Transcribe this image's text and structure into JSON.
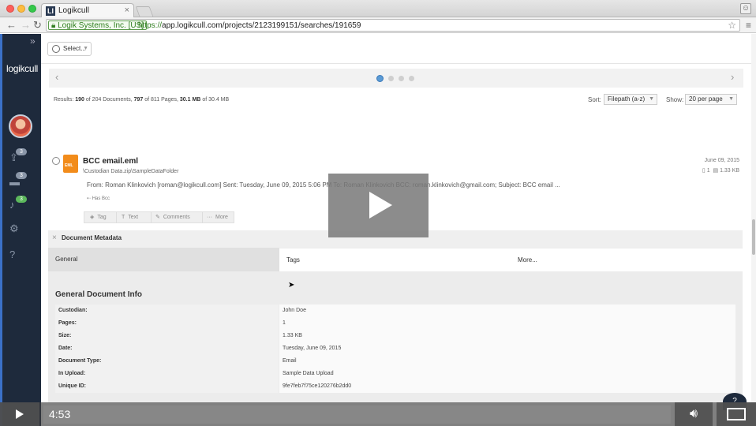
{
  "browser": {
    "tab_title": "Logikcull",
    "tab_favicon": "LI",
    "ev_cert": "Logik Systems, Inc. [US]",
    "url_protocol": "https://",
    "url_rest": "app.logikcull.com/projects/2123199151/searches/191659"
  },
  "app": {
    "logo": "logikcull",
    "badges": {
      "uploads": "3",
      "folders": "3",
      "notifications": "3"
    }
  },
  "toolbar": {
    "select_label": "Select..."
  },
  "results": {
    "summary_prefix": "Results:",
    "docs_shown": "190",
    "docs_of": "of 204 Documents,",
    "pages_shown": "797",
    "pages_of": "of 811 Pages,",
    "size_shown": "30.1 MB",
    "size_of": "of 30.4 MB",
    "sort_label": "Sort:",
    "sort_value": "Filepath (a-z)",
    "show_label": "Show:",
    "show_value": "20 per page"
  },
  "document": {
    "icon_label": "EML",
    "title": "BCC email.eml",
    "path": "\\Custodian Data.zip\\SampleDataFolder",
    "date": "June 09, 2015",
    "pages": "1",
    "size": "1.33 KB",
    "snippet": "From: Roman Klinkovich [roman@logikcull.com] Sent: Tuesday, June 09, 2015 5:06 PM To: Roman Klinkovich BCC: roman.klinkovich@gmail.com; Subject: BCC email ...",
    "tag_note": "Has Bcc",
    "actions": [
      "Tag",
      "Text",
      "Comments",
      "More"
    ]
  },
  "metadata": {
    "title": "Document Metadata",
    "tabs": [
      "General",
      "Tags",
      "More..."
    ],
    "section_title": "General Document Info",
    "rows": [
      {
        "key": "Custodian:",
        "value": "John Doe"
      },
      {
        "key": "Pages:",
        "value": "1"
      },
      {
        "key": "Size:",
        "value": "1.33 KB"
      },
      {
        "key": "Date:",
        "value": "Tuesday, June 09, 2015"
      },
      {
        "key": "Document Type:",
        "value": "Email"
      },
      {
        "key": "In Upload:",
        "value": "Sample Data Upload"
      },
      {
        "key": "Unique ID:",
        "value": "9fe7feb7f75ce120276b2dd0"
      }
    ]
  },
  "video": {
    "time": "4:53"
  },
  "colors": {
    "sidebar": "#1e2a3c",
    "accent": "#3b71c8",
    "doc_icon": "#f28c1b",
    "badge_green": "#5cb85c"
  },
  "icons": [
    "back-icon",
    "forward-icon",
    "reload-icon",
    "lock-icon",
    "star-icon",
    "menu-icon",
    "user-icon",
    "gear-icon",
    "help-icon",
    "bell-icon",
    "folder-icon",
    "upload-icon",
    "play-icon",
    "volume-icon",
    "fullscreen-icon"
  ]
}
